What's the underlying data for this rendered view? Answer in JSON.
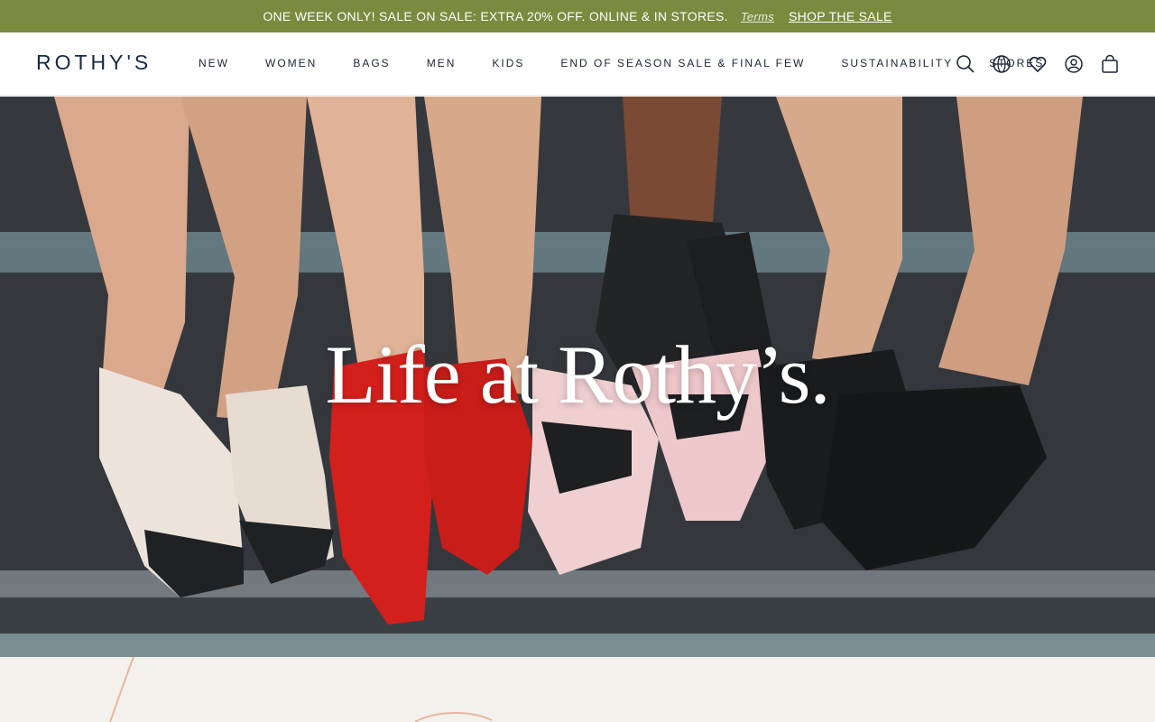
{
  "promo": {
    "message": "ONE WEEK ONLY! SALE ON SALE: EXTRA 20% OFF. ONLINE & IN STORES.",
    "terms_label": "Terms",
    "cta_label": "SHOP THE SALE",
    "background_color": "#7b8a3e"
  },
  "header": {
    "logo": "ROTHY'S",
    "nav": [
      {
        "label": "NEW"
      },
      {
        "label": "WOMEN"
      },
      {
        "label": "BAGS"
      },
      {
        "label": "MEN"
      },
      {
        "label": "KIDS"
      },
      {
        "label": "END OF SEASON SALE & FINAL FEW"
      },
      {
        "label": "SUSTAINABILITY"
      },
      {
        "label": "STORES"
      }
    ],
    "icons": [
      "search-icon",
      "globe-icon",
      "heart-icon",
      "account-icon",
      "bag-icon"
    ]
  },
  "hero": {
    "title": "Life at Rothy’s."
  },
  "colors": {
    "brand_navy": "#162a46",
    "bottom_background": "#f4f1ed"
  }
}
